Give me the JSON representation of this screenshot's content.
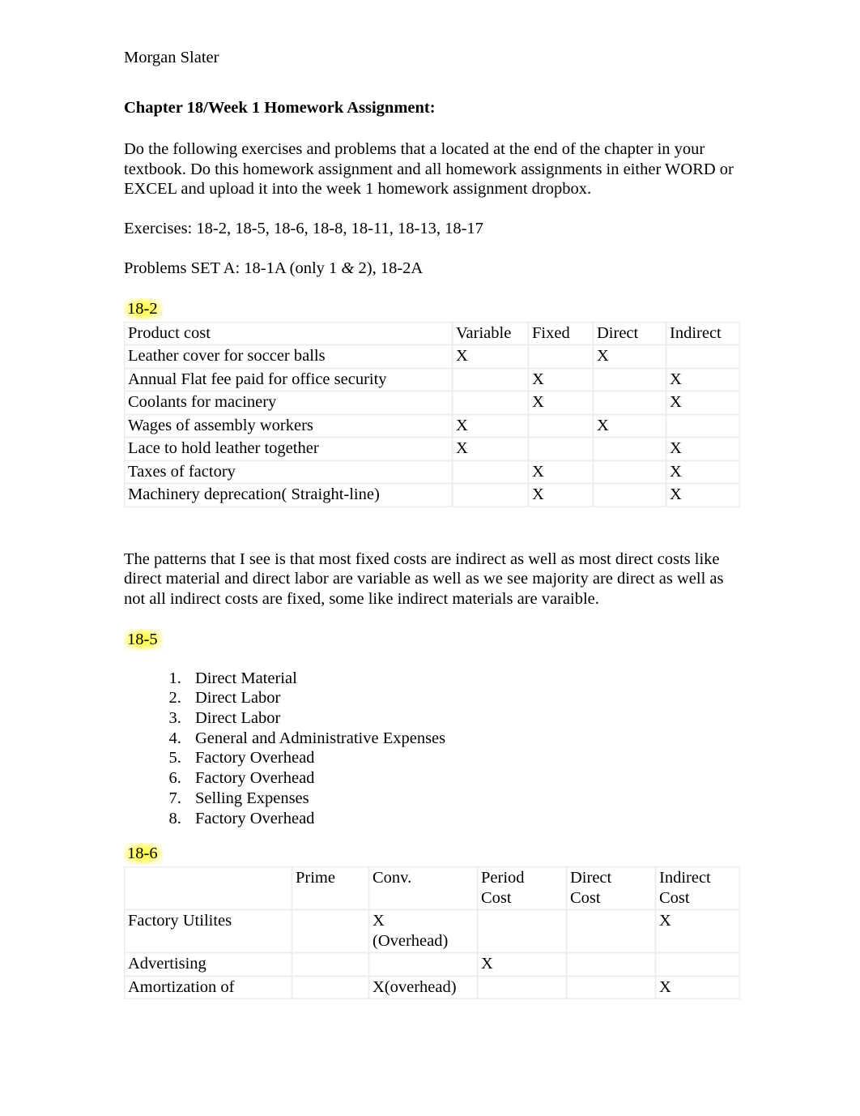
{
  "document": {
    "author": "Morgan Slater",
    "title": "Chapter 18/Week 1 Homework Assignment:",
    "intro_paragraph": "Do the following exercises and problems that a located at the end of the chapter in your textbook.  Do this homework assignment and all homework assignments in either WORD or EXCEL and upload it into the week 1 homework assignment dropbox.",
    "exercises_line": "Exercises:  18-2, 18-5, 18-6, 18-8, 18-11, 18-13, 18-17",
    "problems_line_prefix": "Problems SET A:  18-1A (only 1 ",
    "problems_line_amp": "&",
    "problems_line_suffix": " 2), 18-2A",
    "patterns_paragraph": "The patterns that I see is that most fixed costs are indirect as well as most direct costs like direct material and direct labor are variable as well as we see majority are direct as well as not all indirect costs are fixed, some like indirect materials are varaible."
  },
  "highlight_color": "#FFFF3C",
  "sections": {
    "s18_2": {
      "label": "18-2",
      "table": {
        "headers": [
          "Product cost",
          "Variable",
          "Fixed",
          "Direct",
          "Indirect"
        ],
        "subheader_row": [
          "Leather cover for soccer balls",
          "X",
          "",
          "X",
          ""
        ],
        "rows": [
          [
            "Annual Flat fee paid for office security",
            "",
            "X",
            "",
            "X"
          ],
          [
            "Coolants for macinery",
            "",
            "X",
            "",
            "X"
          ],
          [
            "Wages of assembly workers",
            "X",
            "",
            "X",
            ""
          ],
          [
            "Lace to hold leather together",
            "X",
            "",
            "",
            "X"
          ],
          [
            "Taxes of factory",
            "",
            "X",
            "",
            "X"
          ],
          [
            "Machinery deprecation( Straight-line)",
            "",
            "X",
            "",
            "X"
          ]
        ]
      }
    },
    "s18_5": {
      "label": "18-5",
      "items": [
        "Direct Material",
        "Direct Labor",
        "Direct Labor",
        "General and Administrative Expenses",
        "Factory Overhead",
        "Factory Overhead",
        "Selling Expenses",
        "Factory Overhead"
      ]
    },
    "s18_6": {
      "label": "18-6",
      "table": {
        "headers": [
          "",
          "Prime",
          "Conv.",
          "Period Cost",
          "Direct Cost",
          "Indirect Cost"
        ],
        "header_lines": {
          "col0": "",
          "col1": "Prime",
          "col2": "Conv.",
          "col3_line1": "Period",
          "col3_line2": "Cost",
          "col4_line1": "Direct",
          "col4_line2": "Cost",
          "col5_line1": "Indirect",
          "col5_line2": "Cost"
        },
        "rows": [
          {
            "name": "Factory Utilites",
            "prime": "",
            "conv_line1": "X",
            "conv_line2": "(Overhead)",
            "period": "",
            "direct": "",
            "indirect": "X"
          },
          {
            "name": "Advertising",
            "prime": "",
            "conv_line1": "",
            "conv_line2": "",
            "period": "X",
            "direct": "",
            "indirect": ""
          },
          {
            "name": "Amortization of",
            "prime": "",
            "conv_line1": "X(overhead)",
            "conv_line2": "",
            "period": "",
            "direct": "",
            "indirect": "X"
          }
        ]
      }
    }
  }
}
